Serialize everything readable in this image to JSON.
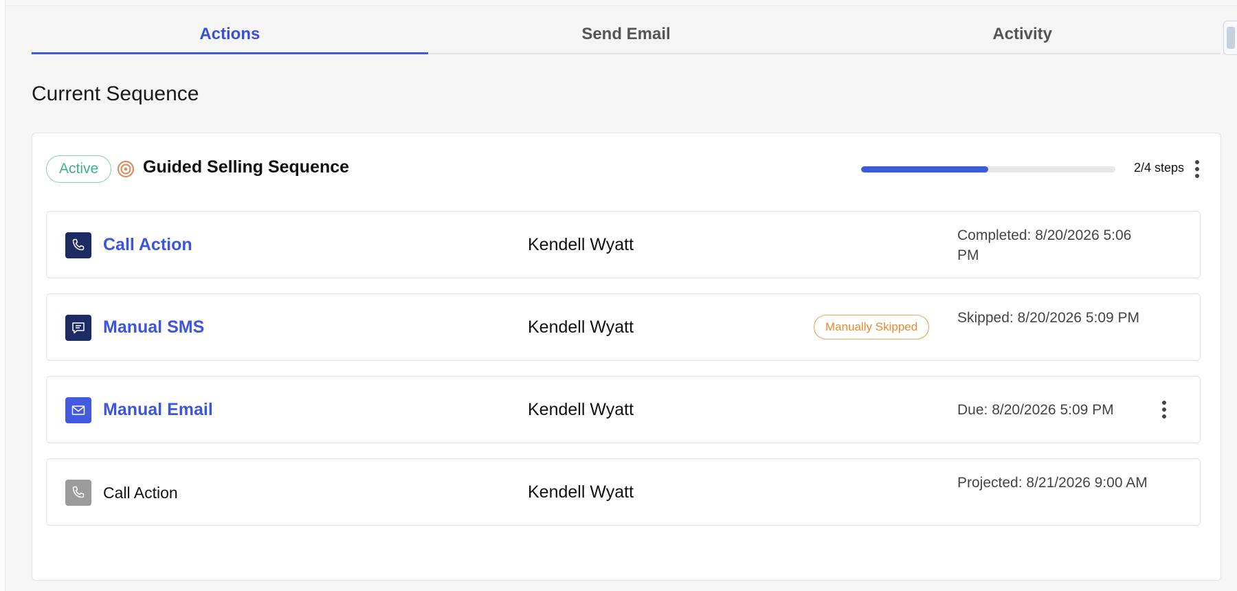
{
  "tabs": [
    {
      "label": "Actions",
      "active": true
    },
    {
      "label": "Send Email",
      "active": false
    },
    {
      "label": "Activity",
      "active": false
    }
  ],
  "section_title": "Current Sequence",
  "sequence": {
    "status_badge": "Active",
    "name": "Guided Selling Sequence",
    "icon": "target-icon",
    "progress_fraction": 0.5,
    "steps_text": "2/4 steps"
  },
  "actions": [
    {
      "title": "Call Action",
      "icon": "phone-icon",
      "person": "Kendell Wyatt",
      "status_badge": "",
      "status": "Completed: 8/20/2026 5:06 PM",
      "style": "link"
    },
    {
      "title": "Manual SMS",
      "icon": "chat-icon",
      "person": "Kendell Wyatt",
      "status_badge": "Manually Skipped",
      "status": "Skipped: 8/20/2026 5:09 PM",
      "style": "link"
    },
    {
      "title": "Manual Email",
      "icon": "mail-icon",
      "person": "Kendell Wyatt",
      "status_badge": "",
      "status": "Due: 8/20/2026 5:09 PM",
      "style": "link"
    },
    {
      "title": "Call Action",
      "icon": "phone-icon",
      "person": "Kendell Wyatt",
      "status_badge": "",
      "status": "Projected: 8/21/2026 9:00 AM",
      "style": "plain"
    }
  ],
  "colors": {
    "accent": "#3b5bdb",
    "active_badge": "#3bb38a",
    "skipped_badge": "#e8892f",
    "dark_icon_bg": "#1d2a63",
    "grey_icon_bg": "#9b9b9b"
  }
}
